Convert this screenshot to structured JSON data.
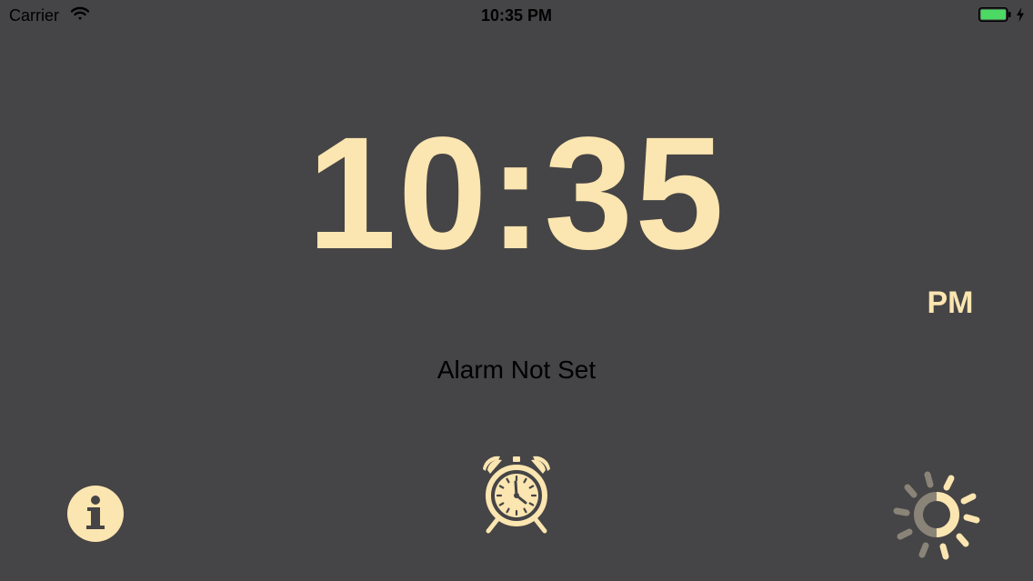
{
  "status_bar": {
    "carrier": "Carrier",
    "time": "10:35 PM",
    "wifi_icon": "wifi-icon",
    "battery_icon": "battery-charging-icon",
    "battery_level": 1.0,
    "battery_color": "#4cd964"
  },
  "clock": {
    "time": "10:35",
    "period": "PM",
    "color": "#fbe5b0"
  },
  "alarm": {
    "status": "Alarm Not Set"
  },
  "toolbar": {
    "info_icon": "info-icon",
    "alarm_icon": "alarm-clock-icon",
    "brightness_icon": "brightness-icon"
  },
  "theme": {
    "background": "#454446",
    "accent": "#fbe5b0"
  }
}
